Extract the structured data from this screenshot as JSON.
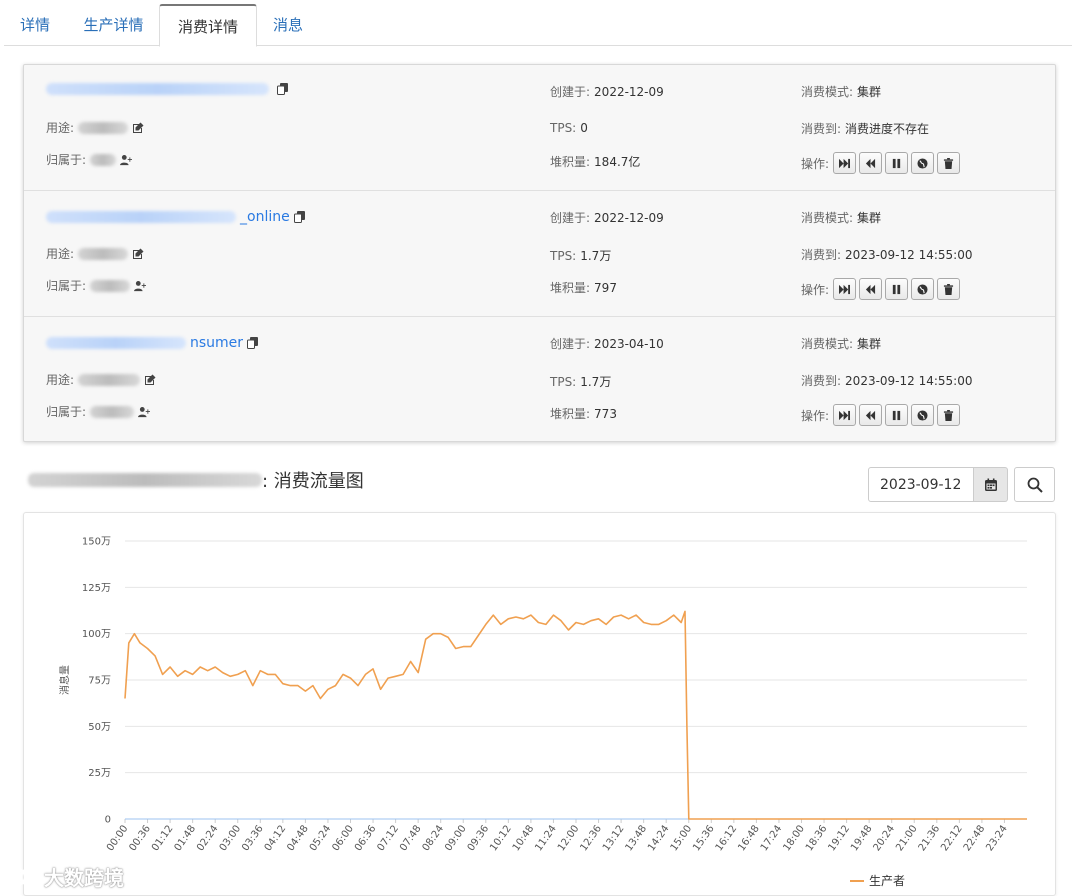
{
  "tabs": [
    {
      "label": "详情",
      "active": false
    },
    {
      "label": "生产详情",
      "active": false
    },
    {
      "label": "消费详情",
      "active": true
    },
    {
      "label": "消息",
      "active": false
    }
  ],
  "labels": {
    "created": "创建于:",
    "tps": "TPS:",
    "backlog": "堆积量:",
    "mode": "消费模式:",
    "consumed_to": "消费到:",
    "operation": "操作:",
    "purpose": "用途:",
    "owner": "归属于:"
  },
  "consumers": [
    {
      "name_suffix": "",
      "created": "2022-12-09",
      "tps": "0",
      "backlog": "184.7亿",
      "mode": "集群",
      "consumed_to": "消费进度不存在"
    },
    {
      "name_suffix": "_online",
      "created": "2022-12-09",
      "tps": "1.7万",
      "backlog": "797",
      "mode": "集群",
      "consumed_to": "2023-09-12 14:55:00"
    },
    {
      "name_suffix": "nsumer",
      "created": "2023-04-10",
      "tps": "1.7万",
      "backlog": "773",
      "mode": "集群",
      "consumed_to": "2023-09-12 14:55:00"
    }
  ],
  "chart_section": {
    "title_suffix": ": 消费流量图",
    "date_value": "2023-09-12"
  },
  "watermark": "大数跨境",
  "icons": [
    "copy-icon",
    "edit-icon",
    "user-plus-icon",
    "skip-forward-icon",
    "rewind-icon",
    "pause-icon",
    "globe-icon",
    "trash-icon",
    "calendar-icon",
    "search-icon"
  ],
  "colors": {
    "link": "#2a7ae2",
    "producer": "#f0a050",
    "consumer_green": "#88e07a",
    "consumer_black": "#333333",
    "consumer_blue": "#7fb2ee"
  },
  "chart_data": {
    "type": "line",
    "ylabel": "消息量",
    "y_ticks": [
      "0",
      "25万",
      "50万",
      "75万",
      "100万",
      "125万",
      "150万"
    ],
    "ylim": [
      0,
      1500000
    ],
    "x_ticks": [
      "00:00",
      "00:36",
      "01:12",
      "01:48",
      "02:24",
      "03:00",
      "03:36",
      "04:12",
      "04:48",
      "05:24",
      "06:00",
      "06:36",
      "07:12",
      "07:48",
      "08:24",
      "09:00",
      "09:36",
      "10:12",
      "10:48",
      "11:24",
      "12:00",
      "12:36",
      "13:12",
      "13:48",
      "14:24",
      "15:00",
      "15:36",
      "16:12",
      "16:48",
      "17:24",
      "18:00",
      "18:36",
      "19:12",
      "19:48",
      "20:24",
      "21:00",
      "21:36",
      "22:12",
      "22:48",
      "23:24"
    ],
    "x_range_hours": [
      0,
      24
    ],
    "grid": true,
    "legend_position": "bottom",
    "series": [
      {
        "name": "生产者",
        "color": "#f0a050",
        "x": [
          0.0,
          0.1,
          0.25,
          0.4,
          0.6,
          0.8,
          1.0,
          1.2,
          1.4,
          1.6,
          1.8,
          2.0,
          2.2,
          2.4,
          2.6,
          2.8,
          3.0,
          3.2,
          3.4,
          3.6,
          3.8,
          4.0,
          4.2,
          4.4,
          4.6,
          4.8,
          5.0,
          5.2,
          5.4,
          5.6,
          5.8,
          6.0,
          6.2,
          6.4,
          6.6,
          6.8,
          7.0,
          7.2,
          7.4,
          7.6,
          7.8,
          8.0,
          8.2,
          8.4,
          8.6,
          8.8,
          9.0,
          9.2,
          9.4,
          9.6,
          9.8,
          10.0,
          10.2,
          10.4,
          10.6,
          10.8,
          11.0,
          11.2,
          11.4,
          11.6,
          11.8,
          12.0,
          12.2,
          12.4,
          12.6,
          12.8,
          13.0,
          13.2,
          13.4,
          13.6,
          13.8,
          14.0,
          14.2,
          14.4,
          14.6,
          14.8,
          14.9,
          14.95,
          15.0,
          16.0,
          18.0,
          20.0,
          22.0,
          24.0
        ],
        "y": [
          650000,
          950000,
          1000000,
          950000,
          920000,
          880000,
          780000,
          820000,
          770000,
          800000,
          780000,
          820000,
          800000,
          820000,
          790000,
          770000,
          780000,
          800000,
          720000,
          800000,
          780000,
          780000,
          730000,
          720000,
          720000,
          690000,
          720000,
          650000,
          700000,
          720000,
          780000,
          760000,
          720000,
          780000,
          810000,
          700000,
          760000,
          770000,
          780000,
          850000,
          790000,
          970000,
          1000000,
          1000000,
          980000,
          920000,
          930000,
          930000,
          990000,
          1050000,
          1100000,
          1050000,
          1080000,
          1090000,
          1080000,
          1100000,
          1060000,
          1050000,
          1100000,
          1070000,
          1020000,
          1060000,
          1050000,
          1070000,
          1080000,
          1050000,
          1090000,
          1100000,
          1080000,
          1100000,
          1060000,
          1050000,
          1050000,
          1070000,
          1100000,
          1060000,
          1120000,
          500000,
          0,
          0,
          0,
          0,
          0,
          0
        ]
      }
    ]
  }
}
